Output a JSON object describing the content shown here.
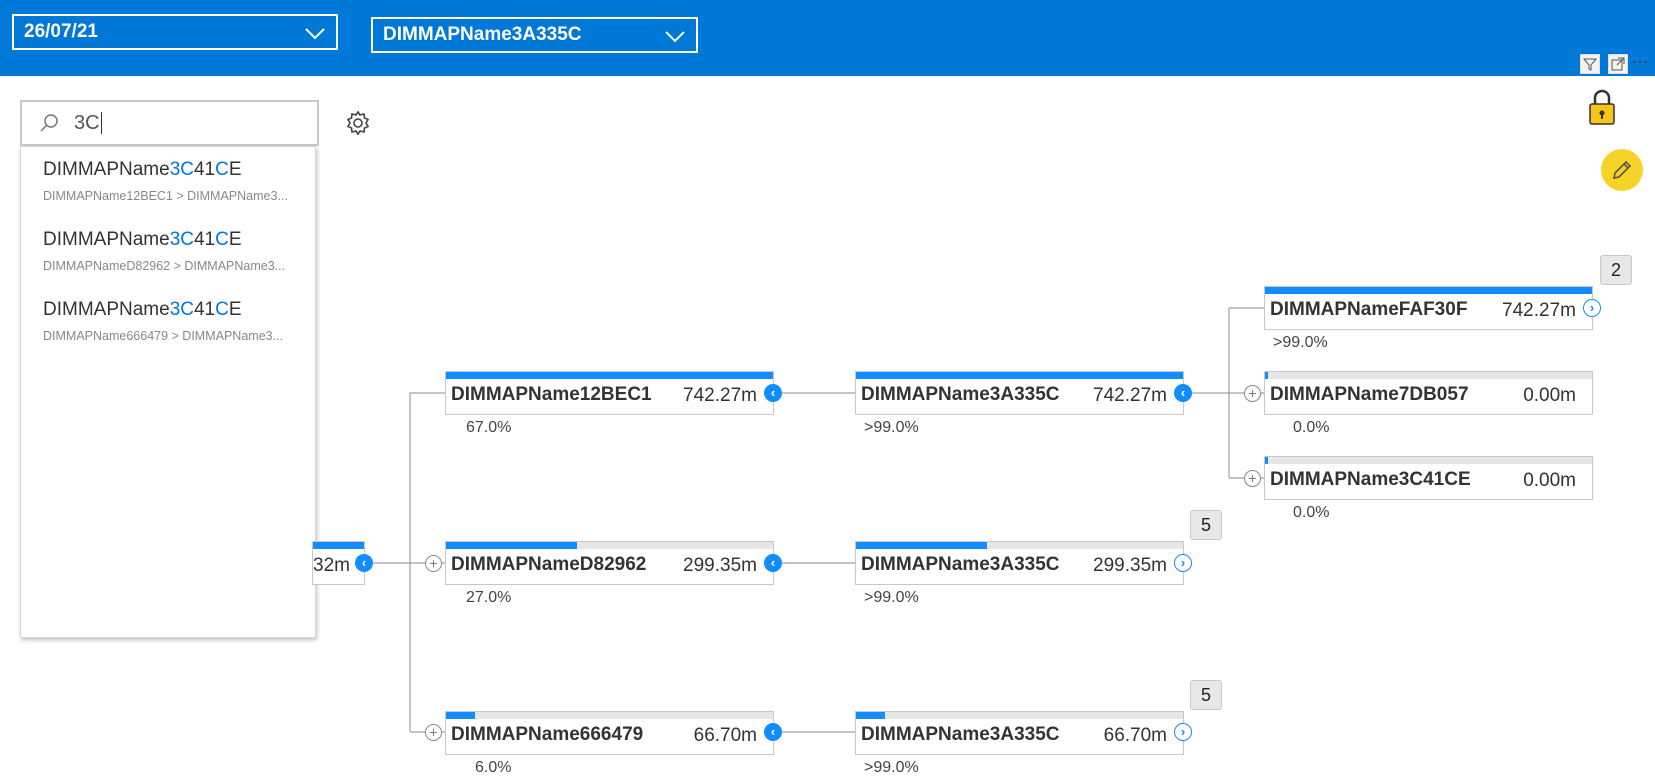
{
  "filters": {
    "date_value": "26/07/21",
    "map_value": "DIMMAPName3A335C"
  },
  "search": {
    "query": "3C",
    "results": [
      {
        "name_parts": [
          "DIMMAPName",
          "3C",
          "41",
          "C",
          "E"
        ],
        "path": "DIMMAPName12BEC1 > DIMMAPName3..."
      },
      {
        "name_parts": [
          "DIMMAPName",
          "3C",
          "41",
          "C",
          "E"
        ],
        "path": "DIMMAPNameD82962 > DIMMAPName3..."
      },
      {
        "name_parts": [
          "DIMMAPName",
          "3C",
          "41",
          "C",
          "E"
        ],
        "path": "DIMMAPName666479 > DIMMAPName3..."
      }
    ]
  },
  "tree": {
    "root": {
      "value": "32m"
    },
    "level1": [
      {
        "label": "DIMMAPName12BEC1",
        "value": "742.27m",
        "pct": "67.0%",
        "fill": 1.0
      },
      {
        "label": "DIMMAPNameD82962",
        "value": "299.35m",
        "pct": "27.0%",
        "fill": 0.4
      },
      {
        "label": "DIMMAPName666479",
        "value": "66.70m",
        "pct": "6.0%",
        "fill": 0.09
      }
    ],
    "level2": [
      {
        "label": "DIMMAPName3A335C",
        "value": "742.27m",
        "pct": ">99.0%",
        "fill": 1.0
      },
      {
        "label": "DIMMAPName3A335C",
        "value": "299.35m",
        "pct": ">99.0%",
        "fill": 0.4,
        "badge": "5"
      },
      {
        "label": "DIMMAPName3A335C",
        "value": "66.70m",
        "pct": ">99.0%",
        "fill": 0.09,
        "badge": "5"
      }
    ],
    "level3": [
      {
        "label": "DIMMAPNameFAF30F",
        "value": "742.27m",
        "pct": ">99.0%",
        "fill": 1.0,
        "badge": "2"
      },
      {
        "label": "DIMMAPName7DB057",
        "value": "0.00m",
        "pct": "0.0%",
        "fill": 0.01
      },
      {
        "label": "DIMMAPName3C41CE",
        "value": "0.00m",
        "pct": "0.0%",
        "fill": 0.01
      }
    ]
  },
  "icons": {
    "collapse": "‹",
    "expand": "›",
    "plus": "+"
  },
  "colors": {
    "header": "#0078d7",
    "bar": "#118dff",
    "highlight": "#0078d7",
    "pencil": "#f5d327"
  }
}
